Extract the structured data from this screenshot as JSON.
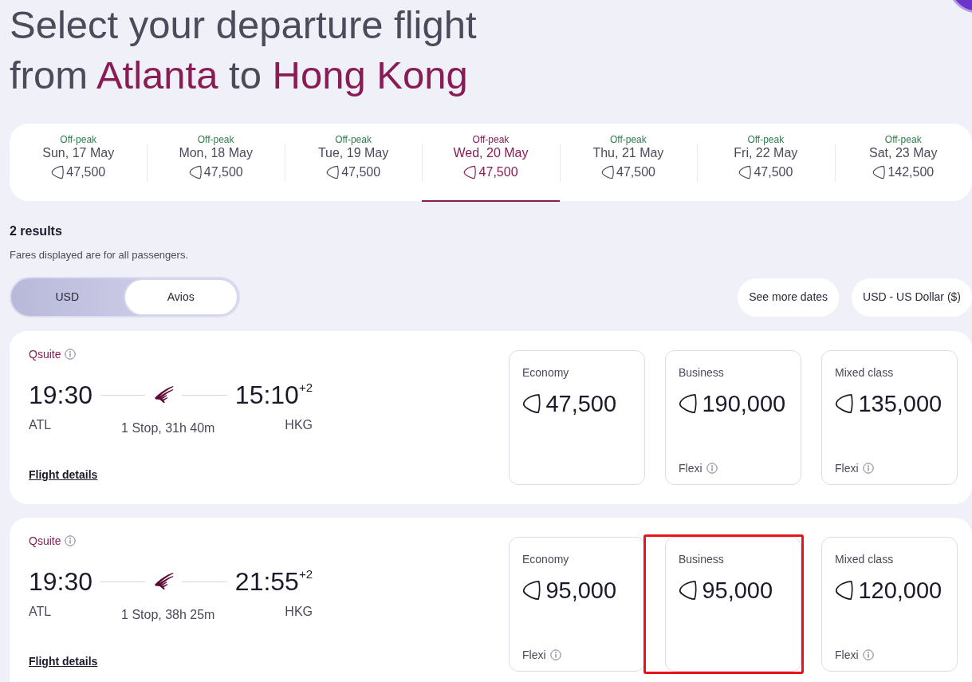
{
  "heading": {
    "lead": "Select your departure flight",
    "from_word": "from",
    "origin": "Atlanta",
    "to_word": "to",
    "destination": "Hong Kong"
  },
  "date_tabs": [
    {
      "tag": "Off-peak",
      "date": "Sun, 17 May",
      "price": "47,500",
      "selected": false
    },
    {
      "tag": "Off-peak",
      "date": "Mon, 18 May",
      "price": "47,500",
      "selected": false
    },
    {
      "tag": "Off-peak",
      "date": "Tue, 19 May",
      "price": "47,500",
      "selected": false
    },
    {
      "tag": "Off-peak",
      "date": "Wed, 20 May",
      "price": "47,500",
      "selected": true
    },
    {
      "tag": "Off-peak",
      "date": "Thu, 21 May",
      "price": "47,500",
      "selected": false
    },
    {
      "tag": "Off-peak",
      "date": "Fri, 22 May",
      "price": "47,500",
      "selected": false
    },
    {
      "tag": "Off-peak",
      "date": "Sat, 23 May",
      "price": "142,500",
      "selected": false
    }
  ],
  "results": {
    "count": "2 results",
    "note": "Fares displayed are for all passengers."
  },
  "currency_toggle": [
    {
      "label": "USD",
      "selected": false
    },
    {
      "label": "Avios",
      "selected": true
    }
  ],
  "buttons": [
    "See more dates",
    "USD - US Dollar ($)"
  ],
  "flights": [
    {
      "cabin": "Qsuite",
      "departure_time": "19:30",
      "arrival_time": "15:10$^{+2}$",
      "origin": "ATL",
      "destination": "HKG",
      "stops": "1 Stop, 31h 40m",
      "details_link": "Flight details",
      "fares": [
        {
          "class": "Economy",
          "price": "47,500",
          "highlighted": false
        },
        {
          "class": "Business",
          "price": "190,000",
          "fare_type": "Flexi",
          "highlighted": false
        },
        {
          "class": "Mixed class",
          "price": "135,000",
          "fare_type": "Flexi",
          "highlighted": false
        }
      ]
    },
    {
      "cabin": "Qsuite",
      "departure_time": "19:30",
      "arrival_time": "21:55$^{+2}$",
      "origin": "ATL",
      "destination": "HKG",
      "stops": "1 Stop, 38h 25m",
      "details_link": "Flight details",
      "fares": [
        {
          "class": "Economy",
          "price": "95,000",
          "fare_type": "Flexi",
          "highlighted": false
        },
        {
          "class": "Business",
          "price": "95,000",
          "highlighted": true
        },
        {
          "class": "Mixed class",
          "price": "120,000",
          "fare_type": "Flexi",
          "highlighted": false
        }
      ]
    }
  ]
}
